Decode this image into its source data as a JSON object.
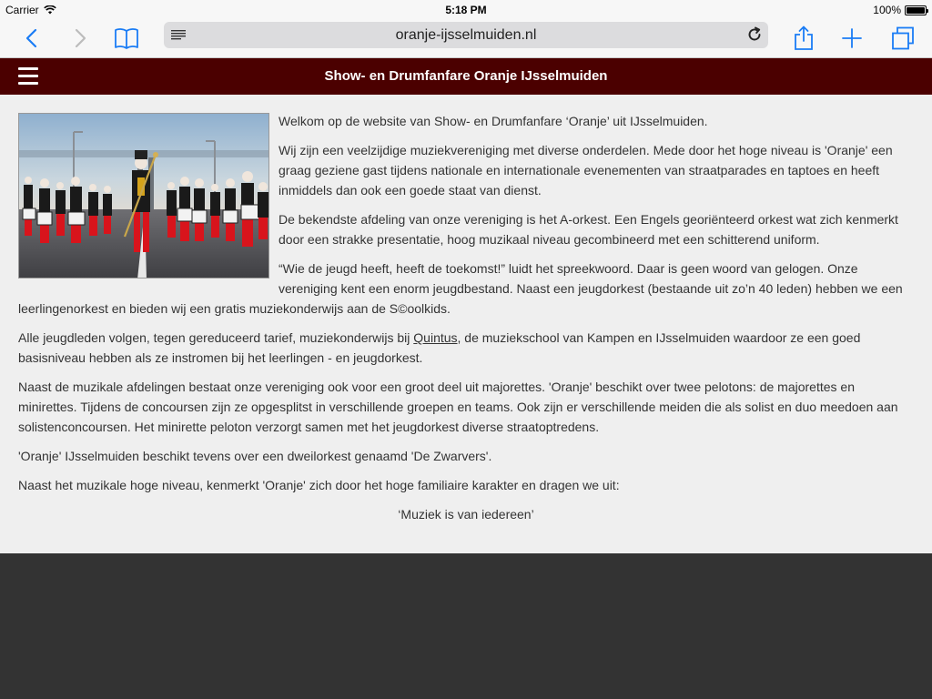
{
  "status": {
    "carrier": "Carrier",
    "time": "5:18 PM",
    "battery_pct": "100%",
    "battery_level": 1.0
  },
  "browser": {
    "url": "oranje-ijsselmuiden.nl",
    "icons": [
      "back-icon",
      "forward-icon",
      "bookmarks-icon",
      "reader-icon",
      "reload-icon",
      "share-icon",
      "add-icon",
      "tabs-icon"
    ]
  },
  "header": {
    "title": "Show- en Drumfanfare Oranje IJsselmuiden"
  },
  "content": {
    "p1": "Welkom op de website van Show- en Drumfanfare ‘Oranje’ uit IJsselmuiden.",
    "p2": "Wij zijn een veelzijdige muziekvereniging met diverse onderdelen. Mede door het hoge niveau is 'Oranje' een graag geziene gast tijdens nationale en internationale evenementen van straatparades en taptoes en heeft inmiddels dan ook een goede staat van dienst.",
    "p3": "De bekendste afdeling van onze vereniging is het A-orkest. Een Engels georiënteerd orkest wat zich kenmerkt door een strakke presentatie, hoog muzikaal niveau gecombineerd met een schitterend uniform.",
    "p4": "“Wie de jeugd heeft, heeft de toekomst!” luidt het spreekwoord. Daar is geen woord van gelogen. Onze vereniging kent een enorm jeugdbestand. Naast een jeugdorkest (bestaande uit zo’n 40 leden) hebben we een leerlingenorkest en bieden wij een gratis muziekonderwijs aan de S©oolkids.",
    "p5_before": "Alle jeugdleden volgen, tegen gereduceerd tarief, muziekonderwijs bij ",
    "p5_link": "Quintus",
    "p5_after": ", de muziekschool van Kampen en IJsselmuiden waardoor ze een goed basisniveau hebben als ze instromen bij het leerlingen - en jeugdorkest.",
    "p6": "Naast de muzikale afdelingen bestaat onze vereniging ook voor een groot deel uit majorettes. 'Oranje' beschikt over twee pelotons: de majorettes en minirettes. Tijdens de concoursen zijn ze opgesplitst in verschillende groepen en teams. Ook zijn er verschillende meiden die als solist en duo meedoen aan solistenconcoursen. Het minirette peloton verzorgt samen met het jeugdorkest diverse straatoptredens.",
    "p7": "'Oranje' IJsselmuiden beschikt tevens over een dweilorkest genaamd 'De Zwarvers'.",
    "p8": "Naast het muzikale hoge niveau, kenmerkt 'Oranje' zich door het hoge familiaire karakter en dragen we uit:",
    "motto": "‘Muziek is van iedereen’"
  },
  "colors": {
    "header_bg": "#4b0000",
    "content_bg": "#efefef",
    "footer_bg": "#333333",
    "ios_blue": "#1a7cf5"
  }
}
